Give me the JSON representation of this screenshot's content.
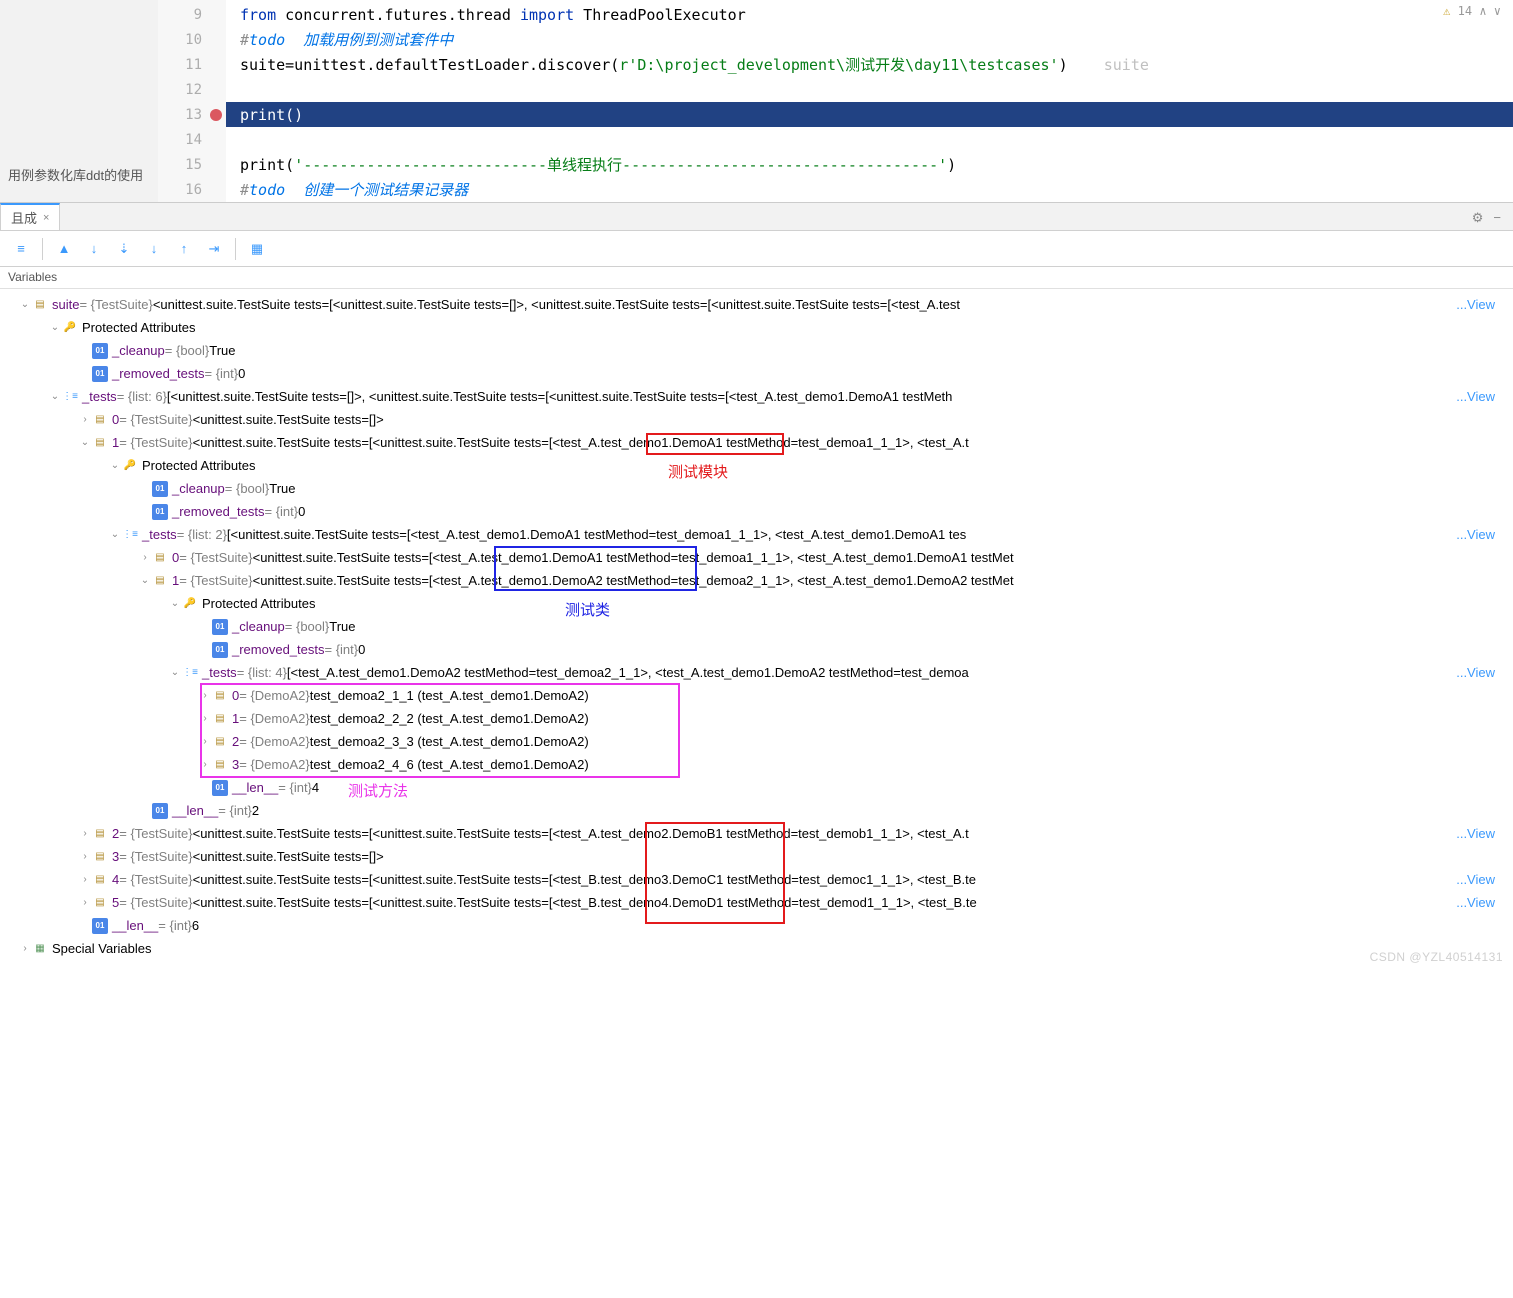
{
  "top_right": {
    "warn_count": "14",
    "warn_icon": "⚠"
  },
  "side_label": "用例参数化库ddt的使用",
  "code_lines": [
    {
      "num": "9",
      "html": "<span class='kw'>from</span> concurrent.futures.thread <span class='kw'>import</span> ThreadPoolExecutor"
    },
    {
      "num": "10",
      "html": "<span class='cm'>#</span><span class='cm2'>todo  加载用例到测试套件中</span>"
    },
    {
      "num": "11",
      "html": "suite=unittest.defaultTestLoader.discover(<span class='str'>r'D:\\project_development\\测试开发\\day11\\testcases'</span>)    <span class='faded'>suite</span>"
    },
    {
      "num": "12",
      "html": ""
    },
    {
      "num": "13",
      "html": "print()",
      "hl": true,
      "bp": true
    },
    {
      "num": "14",
      "html": ""
    },
    {
      "num": "15",
      "html": "print(<span class='str'>'---------------------------单线程执行-----------------------------------'</span>)"
    },
    {
      "num": "16",
      "html": "<span class='cm'>#</span><span class='cm2'>todo  创建一个测试结果记录器</span>"
    }
  ],
  "tab": {
    "label": "且成",
    "close": "×"
  },
  "tab_tools": {
    "gear": "⚙",
    "minus": "−"
  },
  "toolbar_icons": [
    "≡",
    "▲",
    "↓",
    "⇣",
    "↓",
    "↑",
    "⇥",
    "▦"
  ],
  "var_header": "Variables",
  "tree": [
    {
      "d": 0,
      "c": "v",
      "ico": "obj",
      "name": "suite",
      "type": " = {TestSuite} ",
      "val": "<unittest.suite.TestSuite tests=[<unittest.suite.TestSuite tests=[]>, <unittest.suite.TestSuite tests=[<unittest.suite.TestSuite tests=[<test_A.test",
      "view": true
    },
    {
      "d": 1,
      "c": "v",
      "ico": "key",
      "plain": "Protected Attributes"
    },
    {
      "d": 2,
      "c": "",
      "ico": "01",
      "name": "_cleanup",
      "type": " = {bool} ",
      "val": "True"
    },
    {
      "d": 2,
      "c": "",
      "ico": "01",
      "name": "_removed_tests",
      "type": " = {int} ",
      "val": "0"
    },
    {
      "d": 1,
      "c": "v",
      "ico": "list",
      "name": "_tests",
      "type": " = {list: 6} ",
      "val": "[<unittest.suite.TestSuite tests=[]>, <unittest.suite.TestSuite tests=[<unittest.suite.TestSuite tests=[<test_A.test_demo1.DemoA1 testMeth",
      "view": true
    },
    {
      "d": 2,
      "c": ">",
      "ico": "obj",
      "name": "0",
      "type": " = {TestSuite} ",
      "val": "<unittest.suite.TestSuite tests=[]>"
    },
    {
      "d": 2,
      "c": "v",
      "ico": "obj",
      "name": "1",
      "type": " = {TestSuite} ",
      "val": "<unittest.suite.TestSuite tests=[<unittest.suite.TestSuite tests=[<test_A.test_demo1.DemoA1 testMethod=test_demoa1_1_1>, <test_A.t"
    },
    {
      "d": 3,
      "c": "v",
      "ico": "key",
      "plain": "Protected Attributes"
    },
    {
      "d": 4,
      "c": "",
      "ico": "01",
      "name": "_cleanup",
      "type": " = {bool} ",
      "val": "True"
    },
    {
      "d": 4,
      "c": "",
      "ico": "01",
      "name": "_removed_tests",
      "type": " = {int} ",
      "val": "0"
    },
    {
      "d": 3,
      "c": "v",
      "ico": "list",
      "name": "_tests",
      "type": " = {list: 2} ",
      "val": "[<unittest.suite.TestSuite tests=[<test_A.test_demo1.DemoA1 testMethod=test_demoa1_1_1>, <test_A.test_demo1.DemoA1 tes",
      "view": true
    },
    {
      "d": 4,
      "c": ">",
      "ico": "obj",
      "name": "0",
      "type": " = {TestSuite} ",
      "val": "<unittest.suite.TestSuite tests=[<test_A.test_demo1.DemoA1 testMethod=test_demoa1_1_1>, <test_A.test_demo1.DemoA1 testMet"
    },
    {
      "d": 4,
      "c": "v",
      "ico": "obj",
      "name": "1",
      "type": " = {TestSuite} ",
      "val": "<unittest.suite.TestSuite tests=[<test_A.test_demo1.DemoA2 testMethod=test_demoa2_1_1>, <test_A.test_demo1.DemoA2 testMet"
    },
    {
      "d": 5,
      "c": "v",
      "ico": "key",
      "plain": "Protected Attributes"
    },
    {
      "d": 6,
      "c": "",
      "ico": "01",
      "name": "_cleanup",
      "type": " = {bool} ",
      "val": "True"
    },
    {
      "d": 6,
      "c": "",
      "ico": "01",
      "name": "_removed_tests",
      "type": " = {int} ",
      "val": "0"
    },
    {
      "d": 5,
      "c": "v",
      "ico": "list",
      "name": "_tests",
      "type": " = {list: 4} ",
      "val": "[<test_A.test_demo1.DemoA2 testMethod=test_demoa2_1_1>, <test_A.test_demo1.DemoA2 testMethod=test_demoa",
      "view": true
    },
    {
      "d": 6,
      "c": ">",
      "ico": "obj",
      "name": "0",
      "type": " = {DemoA2} ",
      "val": "test_demoa2_1_1 (test_A.test_demo1.DemoA2)"
    },
    {
      "d": 6,
      "c": ">",
      "ico": "obj",
      "name": "1",
      "type": " = {DemoA2} ",
      "val": "test_demoa2_2_2 (test_A.test_demo1.DemoA2)"
    },
    {
      "d": 6,
      "c": ">",
      "ico": "obj",
      "name": "2",
      "type": " = {DemoA2} ",
      "val": "test_demoa2_3_3 (test_A.test_demo1.DemoA2)"
    },
    {
      "d": 6,
      "c": ">",
      "ico": "obj",
      "name": "3",
      "type": " = {DemoA2} ",
      "val": "test_demoa2_4_6 (test_A.test_demo1.DemoA2)"
    },
    {
      "d": 6,
      "c": "",
      "ico": "01",
      "name": "__len__",
      "type": " = {int} ",
      "val": "4"
    },
    {
      "d": 4,
      "c": "",
      "ico": "01",
      "name": "__len__",
      "type": " = {int} ",
      "val": "2"
    },
    {
      "d": 2,
      "c": ">",
      "ico": "obj",
      "name": "2",
      "type": " = {TestSuite} ",
      "val": "<unittest.suite.TestSuite tests=[<unittest.suite.TestSuite tests=[<test_A.test_demo2.DemoB1 testMethod=test_demob1_1_1>, <test_A.t",
      "view": true
    },
    {
      "d": 2,
      "c": ">",
      "ico": "obj",
      "name": "3",
      "type": " = {TestSuite} ",
      "val": "<unittest.suite.TestSuite tests=[]>"
    },
    {
      "d": 2,
      "c": ">",
      "ico": "obj",
      "name": "4",
      "type": " = {TestSuite} ",
      "val": "<unittest.suite.TestSuite tests=[<unittest.suite.TestSuite tests=[<test_B.test_demo3.DemoC1 testMethod=test_democ1_1_1>, <test_B.te",
      "view": true
    },
    {
      "d": 2,
      "c": ">",
      "ico": "obj",
      "name": "5",
      "type": " = {TestSuite} ",
      "val": "<unittest.suite.TestSuite tests=[<unittest.suite.TestSuite tests=[<test_B.test_demo4.DemoD1 testMethod=test_demod1_1_1>, <test_B.te",
      "view": true
    },
    {
      "d": 2,
      "c": "",
      "ico": "01",
      "name": "__len__",
      "type": " = {int} ",
      "val": "6"
    },
    {
      "d": 0,
      "c": ">",
      "ico": "sp",
      "plain": "Special Variables"
    }
  ],
  "annotations": {
    "module": "测试模块",
    "class": "测试类",
    "method": "测试方法"
  },
  "view_link": "...View",
  "watermark": "CSDN @YZL40514131"
}
